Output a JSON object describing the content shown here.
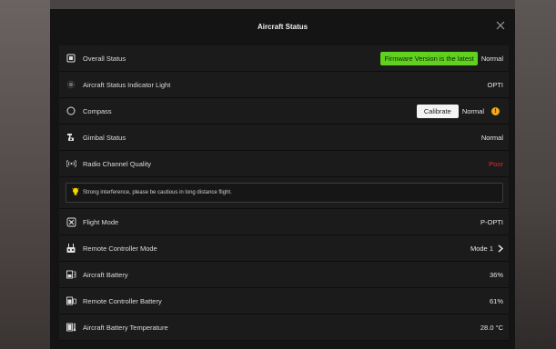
{
  "dialog": {
    "title": "Aircraft Status"
  },
  "rows": {
    "overall_status": {
      "label": "Overall Status",
      "badge": "Firmware Version is the latest",
      "value": "Normal"
    },
    "indicator_light": {
      "label": "Aircraft Status Indicator Light",
      "value": "OPTI"
    },
    "compass": {
      "label": "Compass",
      "button": "Calibrate",
      "value": "Normal",
      "warn": "!"
    },
    "gimbal": {
      "label": "Gimbal Status",
      "value": "Normal"
    },
    "radio": {
      "label": "Radio Channel Quality",
      "value": "Poor"
    },
    "radio_notice": {
      "text": "Strong interference, please be cautious in long distance flight."
    },
    "flight_mode": {
      "label": "Flight Mode",
      "value": "P-OPTI"
    },
    "rc_mode": {
      "label": "Remote Controller Mode",
      "value": "Mode 1"
    },
    "aircraft_battery": {
      "label": "Aircraft Battery",
      "value": "36%"
    },
    "rc_battery": {
      "label": "Remote Controller Battery",
      "value": "61%"
    },
    "battery_temp": {
      "label": "Aircraft Battery Temperature",
      "value": "28.0 °C"
    }
  },
  "colors": {
    "badge_green": "#5fd11e",
    "poor_red": "#e02a2a",
    "warn_orange": "#f0a81a",
    "notice_bulb": "#f5d400"
  }
}
